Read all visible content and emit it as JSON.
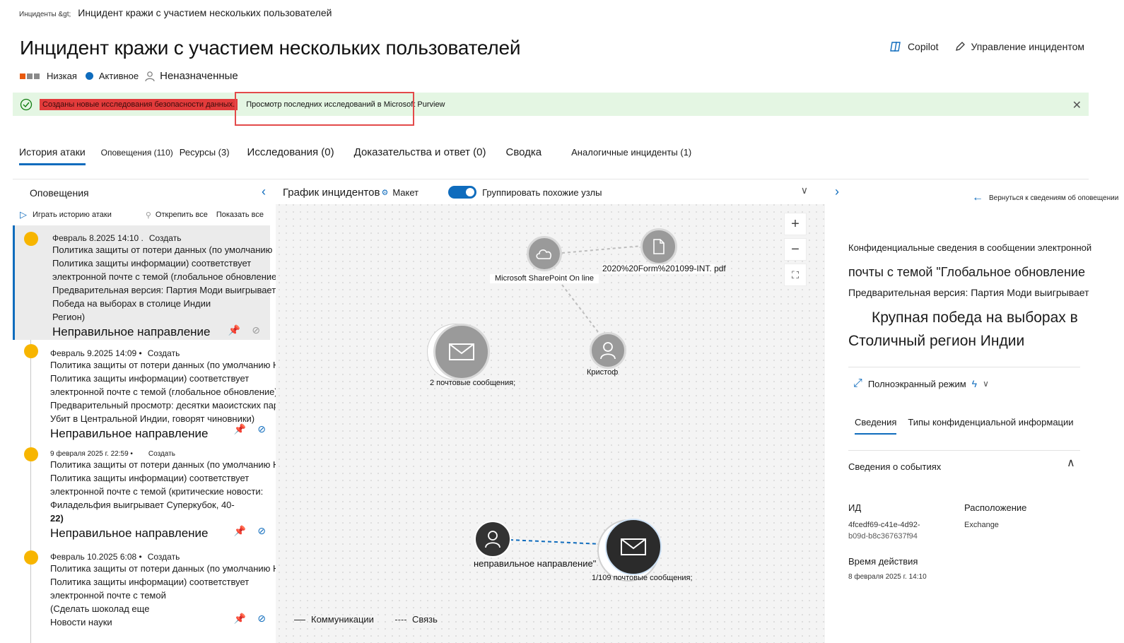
{
  "breadcrumb": {
    "root": "Инциденты &gt;",
    "current": "Инцидент кражи с участием нескольких пользователей"
  },
  "page": {
    "title": "Инцидент кражи с участием нескольких пользователей"
  },
  "actions": {
    "copilot": "Copilot",
    "manage": "Управление инцидентом"
  },
  "status": {
    "severity": "Низкая",
    "state": "Активное",
    "assignee": "Неназначенные"
  },
  "banner": {
    "message": "Созданы новые исследования безопасности данных.",
    "link": "Просмотр последних исследований в Microsoft Purview"
  },
  "tabs": [
    {
      "label": "История атаки"
    },
    {
      "label": "Оповещения (110)"
    },
    {
      "label": "Ресурсы (3)"
    },
    {
      "label": "Исследования (0)"
    },
    {
      "label": "Доказательства и ответ (0)"
    },
    {
      "label": "Сводка"
    },
    {
      "label": "Аналогичные инциденты (1)"
    }
  ],
  "left": {
    "title": "Оповещения",
    "play": "Играть историю атаки",
    "unpin": "Открепить все",
    "showall": "Показать все",
    "alerts": [
      {
        "date": "Февраль 8.2025 14:10 .",
        "action": "Создать",
        "lines": [
          "Политика защиты от потери данных (по умолчанию HR и конфиденциальность)",
          "Политика защиты информации) соответствует",
          "электронной почте с темой (глобальное обновление)",
          "Предварительная версия: Партия Моди выигрывает майора",
          "Победа на выборах в столице Индии",
          "Регион)"
        ],
        "category": "Неправильное направление"
      },
      {
        "date": "Февраль 9.2025 14:09 •",
        "action": "Создать",
        "lines": [
          "Политика защиты от потери данных (по умолчанию HR и конфиденциальность)",
          "Политика защиты информации) соответствует",
          "электронной почте с темой (глобальное обновление)",
          "Предварительный просмотр: десятки маоистских партизан",
          "Убит в Центральной Индии, говорят чиновники)"
        ],
        "category": "Неправильное направление"
      },
      {
        "date": "9 февраля 2025 г. 22:59 •",
        "action": "Создать",
        "lines": [
          "Политика защиты от потери данных (по умолчанию HR и конфиденциальность)",
          "Политика защиты информации) соответствует",
          "электронной почте с темой (критические новости:",
          "Филадельфия выигрывает Суперкубок, 40-",
          "22)"
        ],
        "category": "Неправильное направление"
      },
      {
        "date": "Февраль 10.2025 6:08 •",
        "action": "Создать",
        "lines": [
          "Политика защиты от потери данных (по умолчанию HR и конфиденциальность)",
          "Политика защиты информации) соответствует",
          "электронной почте с темой",
          "(Сделать шоколад еще"
        ],
        "category": "Новости науки"
      }
    ]
  },
  "graph": {
    "title": "График инцидентов",
    "layout": "Макет",
    "group": "Группировать похожие узлы",
    "nodes": {
      "sharepoint": "Microsoft SharePoint On line",
      "file": "2020%20Form%201099-INT. pdf",
      "mail1": "2 почтовые сообщения;",
      "user1": "Кристоф",
      "user2": "неправильное направление\"",
      "mail2": "1/109 почтовые сообщения;"
    },
    "legend": {
      "comm": "Коммуникации",
      "link": "Связь"
    }
  },
  "right": {
    "back": "Вернуться к сведениям об оповещении",
    "t1": "Конфиденциальные сведения в сообщении электронной",
    "t2": "почты с темой \"Глобальное обновление",
    "t3": "Предварительная версия: Партия Моди выигрывает",
    "t4": "Крупная победа на выборах в",
    "t5": "Столичный регион Индии",
    "fullscreen": "Полноэкранный режим",
    "tab1": "Сведения",
    "tab2": "Типы конфиденциальной информации",
    "section": "Сведения о событиях",
    "id_label": "ИД",
    "id_val1": "4fcedf69-c41e-4d92-",
    "id_val2": "b09d-b8c367637f94",
    "loc_label": "Расположение",
    "loc_val": "Exchange",
    "time_label": "Время действия",
    "time_val": "8 февраля 2025 г. 14:10"
  },
  "colors": {
    "accent": "#0f6cbd",
    "severity": "#e8590c",
    "alert_dot": "#f7b500",
    "banner_bg": "#e4f6e3",
    "highlight": "#e23b3b"
  }
}
